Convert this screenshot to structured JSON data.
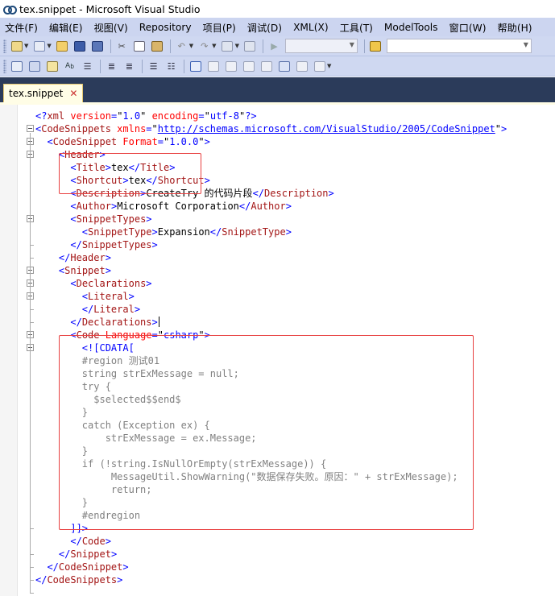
{
  "window": {
    "title": "tex.snippet - Microsoft Visual Studio"
  },
  "menu": [
    "文件(F)",
    "编辑(E)",
    "视图(V)",
    "Repository",
    "项目(P)",
    "调试(D)",
    "XML(X)",
    "工具(T)",
    "ModelTools",
    "窗口(W)",
    "帮助(H)"
  ],
  "toolbar1": {
    "icons": [
      "add-item-icon",
      "new-project-icon",
      "open-file-icon",
      "save-icon",
      "save-all-icon",
      "cut-icon",
      "copy-icon",
      "paste-icon",
      "undo-icon",
      "redo-icon",
      "navigate-back-icon",
      "navigate-forward-icon",
      "start-debug-icon",
      "solution-config-combo",
      "find-in-files-icon",
      "find-combo"
    ]
  },
  "toolbar2": {
    "icons": [
      "xml-schemas-icon",
      "create-schema-icon",
      "show-xslt-icon",
      "spelling-icon",
      "outdent-icon",
      "indent-icon",
      "format-icon",
      "comment-icon",
      "uncomment-icon",
      "bookmark-icon",
      "prev-bookmark-icon",
      "next-bookmark-icon",
      "prev-bookmark-folder-icon",
      "next-bookmark-folder-icon",
      "clear-bookmarks-icon",
      "find-next-icon",
      "find-prev-icon"
    ]
  },
  "tab": {
    "label": "tex.snippet",
    "close": "✕"
  },
  "code_lines": [
    [
      {
        "c": "b",
        "t": "<?"
      },
      {
        "c": "m",
        "t": "xml"
      },
      {
        "c": "t",
        "t": " "
      },
      {
        "c": "a",
        "t": "version"
      },
      {
        "c": "b",
        "t": "="
      },
      {
        "c": "t",
        "t": "\""
      },
      {
        "c": "s",
        "t": "1.0"
      },
      {
        "c": "t",
        "t": "\""
      },
      {
        "c": "t",
        "t": " "
      },
      {
        "c": "a",
        "t": "encoding"
      },
      {
        "c": "b",
        "t": "="
      },
      {
        "c": "t",
        "t": "\""
      },
      {
        "c": "s",
        "t": "utf-8"
      },
      {
        "c": "t",
        "t": "\""
      },
      {
        "c": "b",
        "t": "?>"
      }
    ],
    [
      {
        "c": "b",
        "t": "<"
      },
      {
        "c": "m",
        "t": "CodeSnippets"
      },
      {
        "c": "t",
        "t": " "
      },
      {
        "c": "a",
        "t": "xmlns"
      },
      {
        "c": "b",
        "t": "="
      },
      {
        "c": "t",
        "t": "\""
      },
      {
        "c": "u",
        "t": "http://schemas.microsoft.com/VisualStudio/2005/CodeSnippet"
      },
      {
        "c": "t",
        "t": "\""
      },
      {
        "c": "b",
        "t": ">"
      }
    ],
    [
      {
        "c": "t",
        "t": "  "
      },
      {
        "c": "b",
        "t": "<"
      },
      {
        "c": "m",
        "t": "CodeSnippet"
      },
      {
        "c": "t",
        "t": " "
      },
      {
        "c": "a",
        "t": "Format"
      },
      {
        "c": "b",
        "t": "="
      },
      {
        "c": "t",
        "t": "\""
      },
      {
        "c": "s",
        "t": "1.0.0"
      },
      {
        "c": "t",
        "t": "\""
      },
      {
        "c": "b",
        "t": ">"
      }
    ],
    [
      {
        "c": "t",
        "t": "    "
      },
      {
        "c": "b",
        "t": "<"
      },
      {
        "c": "m",
        "t": "Header"
      },
      {
        "c": "b",
        "t": ">"
      }
    ],
    [
      {
        "c": "t",
        "t": "      "
      },
      {
        "c": "b",
        "t": "<"
      },
      {
        "c": "m",
        "t": "Title"
      },
      {
        "c": "b",
        "t": ">"
      },
      {
        "c": "t",
        "t": "tex"
      },
      {
        "c": "b",
        "t": "</"
      },
      {
        "c": "m",
        "t": "Title"
      },
      {
        "c": "b",
        "t": ">"
      }
    ],
    [
      {
        "c": "t",
        "t": "      "
      },
      {
        "c": "b",
        "t": "<"
      },
      {
        "c": "m",
        "t": "Shortcut"
      },
      {
        "c": "b",
        "t": ">"
      },
      {
        "c": "t",
        "t": "tex"
      },
      {
        "c": "b",
        "t": "</"
      },
      {
        "c": "m",
        "t": "Shortcut"
      },
      {
        "c": "b",
        "t": ">"
      }
    ],
    [
      {
        "c": "t",
        "t": "      "
      },
      {
        "c": "b",
        "t": "<"
      },
      {
        "c": "m",
        "t": "Description"
      },
      {
        "c": "b",
        "t": ">"
      },
      {
        "c": "t",
        "t": "CreateTry 的代码片段"
      },
      {
        "c": "b",
        "t": "</"
      },
      {
        "c": "m",
        "t": "Description"
      },
      {
        "c": "b",
        "t": ">"
      }
    ],
    [
      {
        "c": "t",
        "t": "      "
      },
      {
        "c": "b",
        "t": "<"
      },
      {
        "c": "m",
        "t": "Author"
      },
      {
        "c": "b",
        "t": ">"
      },
      {
        "c": "t",
        "t": "Microsoft Corporation"
      },
      {
        "c": "b",
        "t": "</"
      },
      {
        "c": "m",
        "t": "Author"
      },
      {
        "c": "b",
        "t": ">"
      }
    ],
    [
      {
        "c": "t",
        "t": "      "
      },
      {
        "c": "b",
        "t": "<"
      },
      {
        "c": "m",
        "t": "SnippetTypes"
      },
      {
        "c": "b",
        "t": ">"
      }
    ],
    [
      {
        "c": "t",
        "t": "        "
      },
      {
        "c": "b",
        "t": "<"
      },
      {
        "c": "m",
        "t": "SnippetType"
      },
      {
        "c": "b",
        "t": ">"
      },
      {
        "c": "t",
        "t": "Expansion"
      },
      {
        "c": "b",
        "t": "</"
      },
      {
        "c": "m",
        "t": "SnippetType"
      },
      {
        "c": "b",
        "t": ">"
      }
    ],
    [
      {
        "c": "t",
        "t": "      "
      },
      {
        "c": "b",
        "t": "</"
      },
      {
        "c": "m",
        "t": "SnippetTypes"
      },
      {
        "c": "b",
        "t": ">"
      }
    ],
    [
      {
        "c": "t",
        "t": "    "
      },
      {
        "c": "b",
        "t": "</"
      },
      {
        "c": "m",
        "t": "Header"
      },
      {
        "c": "b",
        "t": ">"
      }
    ],
    [
      {
        "c": "t",
        "t": "    "
      },
      {
        "c": "b",
        "t": "<"
      },
      {
        "c": "m",
        "t": "Snippet"
      },
      {
        "c": "b",
        "t": ">"
      }
    ],
    [
      {
        "c": "t",
        "t": "      "
      },
      {
        "c": "b",
        "t": "<"
      },
      {
        "c": "m",
        "t": "Declarations"
      },
      {
        "c": "b",
        "t": ">"
      }
    ],
    [
      {
        "c": "t",
        "t": "        "
      },
      {
        "c": "b",
        "t": "<"
      },
      {
        "c": "m",
        "t": "Literal"
      },
      {
        "c": "b",
        "t": ">"
      }
    ],
    [
      {
        "c": "t",
        "t": "        "
      },
      {
        "c": "b",
        "t": "</"
      },
      {
        "c": "m",
        "t": "Literal"
      },
      {
        "c": "b",
        "t": ">"
      }
    ],
    [
      {
        "c": "t",
        "t": "      "
      },
      {
        "c": "b",
        "t": "</"
      },
      {
        "c": "m",
        "t": "Declarations"
      },
      {
        "c": "b",
        "t": ">"
      }
    ],
    [
      {
        "c": "t",
        "t": "      "
      },
      {
        "c": "b",
        "t": "<"
      },
      {
        "c": "m",
        "t": "Code"
      },
      {
        "c": "t",
        "t": " "
      },
      {
        "c": "a",
        "t": "Language"
      },
      {
        "c": "b",
        "t": "="
      },
      {
        "c": "t",
        "t": "\""
      },
      {
        "c": "s",
        "t": "csharp"
      },
      {
        "c": "t",
        "t": "\""
      },
      {
        "c": "b",
        "t": ">"
      }
    ],
    [
      {
        "c": "t",
        "t": "        "
      },
      {
        "c": "b",
        "t": "<![CDATA["
      }
    ],
    [
      {
        "c": "g",
        "t": "        #region 测试01"
      }
    ],
    [
      {
        "c": "g",
        "t": "        string strExMessage = null;"
      }
    ],
    [
      {
        "c": "g",
        "t": "        try {"
      }
    ],
    [
      {
        "c": "g",
        "t": "          $selected$$end$"
      }
    ],
    [
      {
        "c": "g",
        "t": "        }"
      }
    ],
    [
      {
        "c": "g",
        "t": "        catch (Exception ex) {"
      }
    ],
    [
      {
        "c": "g",
        "t": "            strExMessage = ex.Message;"
      }
    ],
    [
      {
        "c": "g",
        "t": "        }"
      }
    ],
    [
      {
        "c": "g",
        "t": "        if (!string.IsNullOrEmpty(strExMessage)) {"
      }
    ],
    [
      {
        "c": "g",
        "t": "             MessageUtil.ShowWarning(\"数据保存失败。原因：\" + strExMessage);"
      }
    ],
    [
      {
        "c": "g",
        "t": "             return;"
      }
    ],
    [
      {
        "c": "g",
        "t": "        }"
      }
    ],
    [
      {
        "c": "g",
        "t": "        #endregion"
      }
    ],
    [
      {
        "c": "t",
        "t": "      "
      },
      {
        "c": "b",
        "t": "]]>"
      }
    ],
    [
      {
        "c": "t",
        "t": "      "
      },
      {
        "c": "b",
        "t": "</"
      },
      {
        "c": "m",
        "t": "Code"
      },
      {
        "c": "b",
        "t": ">"
      }
    ],
    [
      {
        "c": "t",
        "t": "    "
      },
      {
        "c": "b",
        "t": "</"
      },
      {
        "c": "m",
        "t": "Snippet"
      },
      {
        "c": "b",
        "t": ">"
      }
    ],
    [
      {
        "c": "t",
        "t": "  "
      },
      {
        "c": "b",
        "t": "</"
      },
      {
        "c": "m",
        "t": "CodeSnippet"
      },
      {
        "c": "b",
        "t": ">"
      }
    ],
    [
      {
        "c": "b",
        "t": "</"
      },
      {
        "c": "m",
        "t": "CodeSnippets"
      },
      {
        "c": "b",
        "t": ">"
      }
    ]
  ],
  "colors": {
    "menubar": "#ccd5f0",
    "tabband": "#2b3b5a",
    "tab": "#fffde6",
    "xml_delimiter": "#0000ff",
    "xml_element": "#a31515",
    "xml_attribute": "#ff0000",
    "cdata_text": "#808080",
    "annotation_box": "#e84040"
  }
}
